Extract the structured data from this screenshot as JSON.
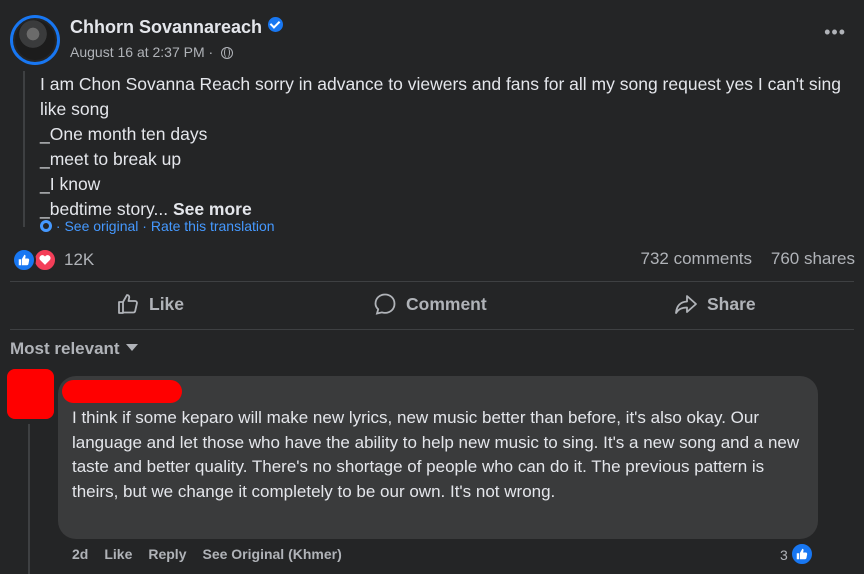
{
  "post": {
    "author": "Chhorn Sovannareach",
    "timestamp": "August 16 at 2:37 PM · ",
    "lines": [
      "I am Chon Sovanna Reach sorry in advance to viewers and fans for all my song request yes I can't sing like song",
      "_One month ten days",
      "_meet to break up",
      "_I know",
      "_bedtime story... "
    ],
    "see_more": "See more",
    "see_original": "· See original",
    "rate_translation": "· Rate this translation"
  },
  "stats": {
    "reactions": "12K",
    "comments": "732 comments",
    "shares": "760 shares"
  },
  "actions": {
    "like": "Like",
    "comment": "Comment",
    "share": "Share"
  },
  "filter": {
    "label": "Most relevant"
  },
  "comment": {
    "text": "I think if some keparo will make new lyrics, new music better than before, it's also okay. Our language and let those who have the ability to help new music to sing. It's a new song and a new taste and better quality. There's no shortage of people who can do it. The previous pattern is theirs, but we change it completely to be our own. It's not wrong.",
    "age": "2d",
    "like": "Like",
    "reply": "Reply",
    "see_original": "See Original (Khmer)",
    "reaction_count": "3"
  },
  "colors": {
    "background": "#242526",
    "bubble": "#3a3b3c",
    "accent": "#1877f2",
    "link": "#4599ff",
    "love": "#f33e58",
    "redaction": "#ff0000"
  },
  "icons": [
    "verified-badge-icon",
    "globe-icon",
    "more-options-icon",
    "like-reaction-icon",
    "love-reaction-icon",
    "thumbs-up-icon",
    "comment-bubble-icon",
    "share-arrow-icon",
    "dropdown-caret-icon",
    "settings-gear-icon"
  ]
}
